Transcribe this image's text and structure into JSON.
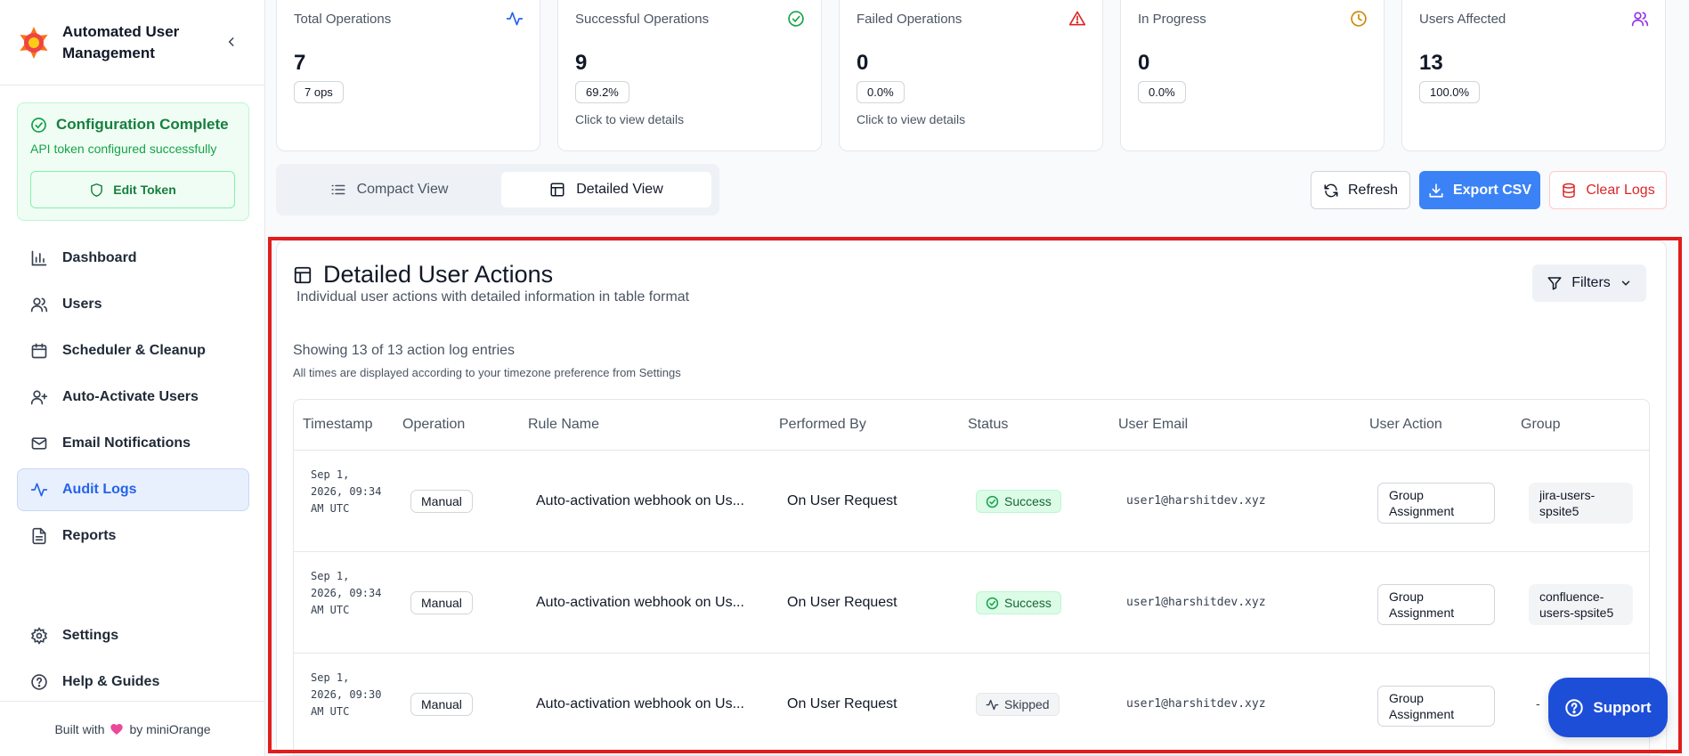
{
  "app": {
    "title": "Automated User Management",
    "collapse_icon": "chevron-left-icon"
  },
  "config": {
    "title": "Configuration Complete",
    "subtitle": "API token configured successfully",
    "edit_token_label": "Edit Token"
  },
  "nav": {
    "items": [
      {
        "label": "Dashboard",
        "icon": "bar-chart-icon"
      },
      {
        "label": "Users",
        "icon": "users-icon"
      },
      {
        "label": "Scheduler & Cleanup",
        "icon": "calendar-icon"
      },
      {
        "label": "Auto-Activate Users",
        "icon": "user-plus-icon"
      },
      {
        "label": "Email Notifications",
        "icon": "mail-icon"
      },
      {
        "label": "Audit Logs",
        "icon": "activity-icon",
        "active": true
      },
      {
        "label": "Reports",
        "icon": "file-text-icon"
      }
    ],
    "bottom": [
      {
        "label": "Settings",
        "icon": "gear-icon"
      },
      {
        "label": "Help & Guides",
        "icon": "help-circle-icon"
      }
    ]
  },
  "footer": {
    "prefix": "Built with",
    "suffix": "by miniOrange"
  },
  "stats": [
    {
      "label": "Total Operations",
      "value": "7",
      "pill": "7 ops",
      "link": "",
      "icon": "activity-icon",
      "color": "#2563eb"
    },
    {
      "label": "Successful Operations",
      "value": "9",
      "pill": "69.2%",
      "link": "Click to view details",
      "icon": "check-circle-icon",
      "color": "#16a34a"
    },
    {
      "label": "Failed Operations",
      "value": "0",
      "pill": "0.0%",
      "link": "Click to view details",
      "icon": "alert-triangle-icon",
      "color": "#dc2626"
    },
    {
      "label": "In Progress",
      "value": "0",
      "pill": "0.0%",
      "link": "",
      "icon": "clock-icon",
      "color": "#ca8a04"
    },
    {
      "label": "Users Affected",
      "value": "13",
      "pill": "100.0%",
      "link": "",
      "icon": "users-icon",
      "color": "#9333ea"
    }
  ],
  "view_toggle": {
    "compact_label": "Compact View",
    "detailed_label": "Detailed View",
    "selected": "Detailed View"
  },
  "actions": {
    "refresh_label": "Refresh",
    "export_label": "Export CSV",
    "clear_label": "Clear Logs"
  },
  "panel": {
    "title": "Detailed User Actions",
    "subtitle": "Individual user actions with detailed information in table format",
    "filters_label": "Filters",
    "showing": "Showing 13 of 13 action log entries",
    "tz_note": "All times are displayed according to your timezone preference from Settings"
  },
  "table": {
    "columns": [
      "Timestamp",
      "Operation",
      "Rule Name",
      "Performed By",
      "Status",
      "User Email",
      "User Action",
      "Group"
    ],
    "rows": [
      {
        "timestamp": "Sep 1, 2026, 09:34 AM UTC",
        "operation": "Manual",
        "rule": "Auto-activation webhook on Us...",
        "performed_by": "On User Request",
        "status": "Success",
        "email": "user1@harshitdev.xyz",
        "user_action": "Group Assignment",
        "group": "jira-users-spsite5"
      },
      {
        "timestamp": "Sep 1, 2026, 09:34 AM UTC",
        "operation": "Manual",
        "rule": "Auto-activation webhook on Us...",
        "performed_by": "On User Request",
        "status": "Success",
        "email": "user1@harshitdev.xyz",
        "user_action": "Group Assignment",
        "group": "confluence-users-spsite5"
      },
      {
        "timestamp": "Sep 1, 2026, 09:30 AM UTC",
        "operation": "Manual",
        "rule": "Auto-activation webhook on Us...",
        "performed_by": "On User Request",
        "status": "Skipped",
        "email": "user1@harshitdev.xyz",
        "user_action": "Group Assignment",
        "group": "-"
      }
    ]
  },
  "support": {
    "label": "Support"
  },
  "colors": {
    "accent": "#3b82f6",
    "success": "#16a34a",
    "danger": "#dc2626",
    "highlight": "#e11d1d"
  }
}
